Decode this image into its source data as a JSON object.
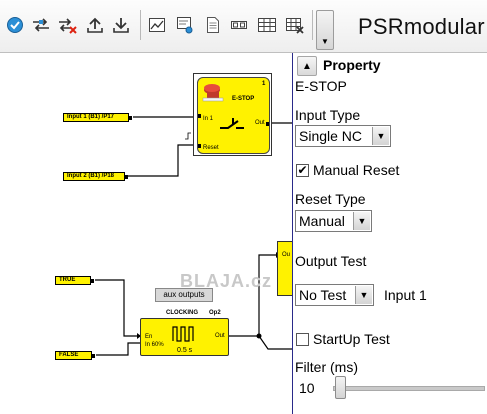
{
  "toolbar": {
    "brand": "PSRmodular",
    "buttons": [
      {
        "icon": "check-circle-icon"
      },
      {
        "icon": "transfer-icon"
      },
      {
        "icon": "transfer-delete-icon"
      },
      {
        "icon": "upload-icon"
      },
      {
        "icon": "download-icon"
      },
      {
        "icon": "graph-icon"
      },
      {
        "icon": "monitor-icon"
      },
      {
        "icon": "document-icon"
      },
      {
        "icon": "glasses-icon"
      },
      {
        "icon": "table-icon"
      },
      {
        "icon": "table-delete-icon"
      }
    ]
  },
  "canvas": {
    "watermark": "BLAJA.cz",
    "aux_button": "aux outputs",
    "estop": {
      "title": "E-STOP",
      "number": "1",
      "pin_in1": "In 1",
      "pin_reset": "Reset",
      "pin_out": "Out"
    },
    "input1": "Input 1 (B1) /P17",
    "input2": "Input 2 (B1) /P18",
    "true_tag": "TRUE",
    "false_tag": "FALSE",
    "clocking": {
      "title": "CLOCKING",
      "op": "Op2",
      "pin_en": "En",
      "pin_in": "In 60%",
      "pin_out": "Out",
      "time": "0.5 s"
    },
    "partial_pin": "Ou"
  },
  "panel": {
    "title": "Property",
    "block_name": "E-STOP",
    "input_type_label": "Input Type",
    "input_type_value": "Single NC",
    "manual_reset_label": "Manual Reset",
    "manual_reset_checked": true,
    "reset_type_label": "Reset Type",
    "reset_type_value": "Manual",
    "output_test_label": "Output Test",
    "output_test_value": "No Test",
    "output_test_input": "Input 1",
    "startup_test_label": "StartUp Test",
    "startup_test_checked": false,
    "filter_label": "Filter (ms)",
    "filter_value": "10"
  }
}
